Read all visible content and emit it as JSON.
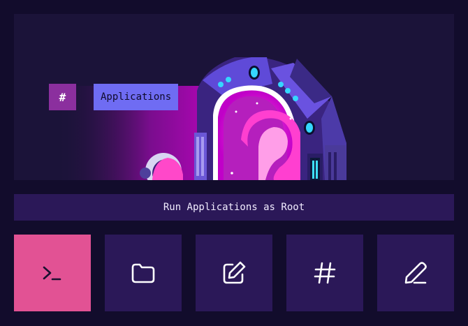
{
  "banner": {
    "hash_symbol": "#",
    "label": "Applications"
  },
  "title_bar": {
    "text": "Run Applications as Root"
  },
  "tiles": [
    {
      "icon": "terminal-icon",
      "active": true
    },
    {
      "icon": "folder-icon",
      "active": false
    },
    {
      "icon": "edit-icon",
      "active": false
    },
    {
      "icon": "hash-icon",
      "active": false
    },
    {
      "icon": "pencil-icon",
      "active": false
    }
  ],
  "colors": {
    "background": "#120c2c",
    "panel": "#2b1858",
    "active_tile": "#e25294",
    "label_bg": "#6f6cf3",
    "hash_bg": "#8b2f9e"
  }
}
